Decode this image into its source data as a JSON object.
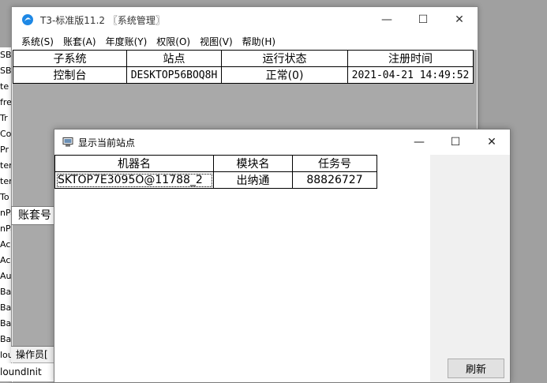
{
  "background_list": {
    "items": [
      "SB",
      "SB",
      "te",
      "fre",
      "Tr",
      "Coo",
      "Pr",
      "ten",
      "ten",
      "To",
      "nPa",
      "nPa",
      "Acc",
      "Acc",
      "Aut",
      "Bac",
      "Bac",
      "Bac",
      "Bac",
      "lou"
    ]
  },
  "behind_fragments": {
    "tab_label": "账套号",
    "status_label": "操作员[",
    "bottom_label": "loundInit"
  },
  "main_window": {
    "title": "T3-标准版11.2 〖系统管理〗",
    "menu": [
      "系统(S)",
      "账套(A)",
      "年度账(Y)",
      "权限(O)",
      "视图(V)",
      "帮助(H)"
    ],
    "columns": [
      "子系统",
      "站点",
      "运行状态",
      "注册时间"
    ],
    "rows": [
      [
        "控制台",
        "DESKTOP56BOQ8H",
        "正常(0)",
        "2021-04-21 14:49:52"
      ]
    ]
  },
  "dialog": {
    "title": "显示当前站点",
    "columns": [
      "机器名",
      "模块名",
      "任务号"
    ],
    "rows": [
      [
        "SKTOP7E3095O@11788_2",
        "出纳通",
        "88826727"
      ]
    ],
    "refresh_label": "刷新"
  },
  "colors": {
    "desktop_bg": "#a0a0a0",
    "window_bg": "#f0f0f0"
  }
}
